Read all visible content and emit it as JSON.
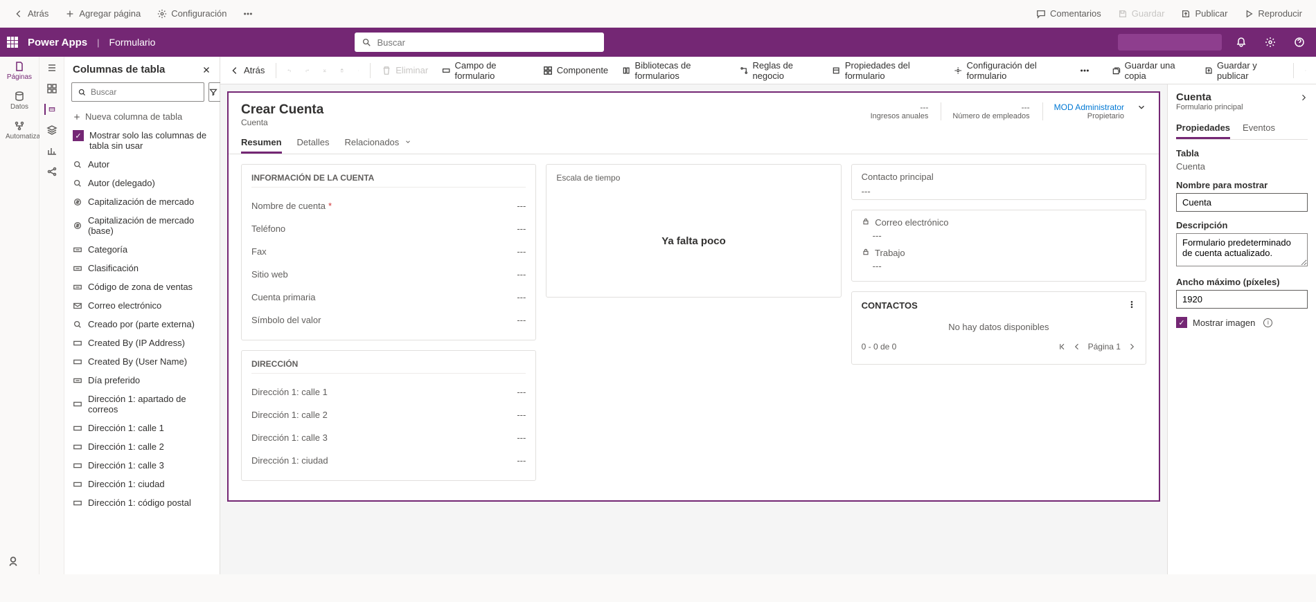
{
  "top_toolbar": {
    "back": "Atrás",
    "add_page": "Agregar página",
    "settings": "Configuración",
    "comments": "Comentarios",
    "save": "Guardar",
    "publish": "Publicar",
    "preview": "Reproducir"
  },
  "purple": {
    "app_name": "Power Apps",
    "sep": "|",
    "form_name": "Formulario",
    "search_placeholder": "Buscar"
  },
  "left_rail": {
    "pages": "Páginas",
    "data": "Datos",
    "automation": "Automatización"
  },
  "command_bar": {
    "back": "Atrás",
    "delete": "Eliminar",
    "form_field": "Campo de formulario",
    "component": "Componente",
    "form_libs": "Bibliotecas de formularios",
    "business_rules": "Reglas de negocio",
    "form_props": "Propiedades del formulario",
    "form_config": "Configuración del formulario",
    "save_copy": "Guardar una copia",
    "save_publish": "Guardar y publicar"
  },
  "columns_panel": {
    "title": "Columnas de tabla",
    "search_placeholder": "Buscar",
    "new_column": "Nueva columna de tabla",
    "show_unused": "Mostrar solo las columnas de tabla sin usar",
    "items": [
      "Autor",
      "Autor (delegado)",
      "Capitalización de mercado",
      "Capitalización de mercado (base)",
      "Categoría",
      "Clasificación",
      "Código de zona de ventas",
      "Correo electrónico",
      "Creado por (parte externa)",
      "Created By (IP Address)",
      "Created By (User Name)",
      "Día preferido",
      "Dirección 1: apartado de correos",
      "Dirección 1: calle 1",
      "Dirección 1: calle 2",
      "Dirección 1: calle 3",
      "Dirección 1: ciudad",
      "Dirección 1: código postal"
    ]
  },
  "form": {
    "title": "Crear Cuenta",
    "subtitle": "Cuenta",
    "header_meta": {
      "revenue_val": "---",
      "revenue_lbl": "Ingresos anuales",
      "employees_val": "---",
      "employees_lbl": "Número de empleados",
      "owner_val": "MOD Administrator",
      "owner_lbl": "Propietario"
    },
    "tabs": {
      "summary": "Resumen",
      "details": "Detalles",
      "related": "Relacionados"
    },
    "sections": {
      "account_info_title": "INFORMACIÓN DE LA CUENTA",
      "address_title": "DIRECCIÓN",
      "timeline_title": "Escala de tiempo",
      "timeline_msg": "Ya falta poco",
      "primary_contact": "Contacto principal",
      "primary_contact_val": "---",
      "email_lbl": "Correo electrónico",
      "email_val": "---",
      "work_lbl": "Trabajo",
      "work_val": "---",
      "contacts_title": "CONTACTOS",
      "no_data": "No hay datos disponibles",
      "pager_count": "0 - 0 de 0",
      "pager_page": "Página 1"
    },
    "fields": {
      "account_name": "Nombre de cuenta",
      "phone": "Teléfono",
      "fax": "Fax",
      "website": "Sitio web",
      "primary_account": "Cuenta primaria",
      "ticker": "Símbolo del valor",
      "addr1_street1": "Dirección 1: calle 1",
      "addr1_street2": "Dirección 1: calle 2",
      "addr1_street3": "Dirección 1: calle 3",
      "addr1_city": "Dirección 1: ciudad",
      "dash": "---"
    }
  },
  "props": {
    "title": "Cuenta",
    "subtitle": "Formulario principal",
    "tab_props": "Propiedades",
    "tab_events": "Eventos",
    "table_lbl": "Tabla",
    "table_val": "Cuenta",
    "display_name_lbl": "Nombre para mostrar",
    "display_name_val": "Cuenta",
    "description_lbl": "Descripción",
    "description_val": "Formulario predeterminado de cuenta actualizado.",
    "max_width_lbl": "Ancho máximo (píxeles)",
    "max_width_val": "1920",
    "show_image": "Mostrar imagen"
  }
}
